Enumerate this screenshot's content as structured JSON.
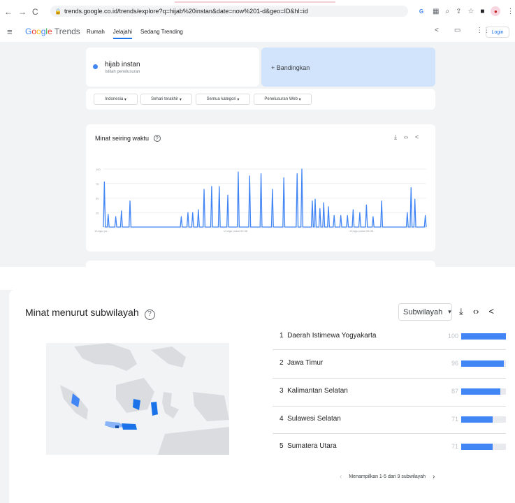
{
  "browser": {
    "url": "trends.google.co.id/trends/explore?q=hijab%20instan&date=now%201-d&geo=ID&hl=id",
    "profile_letter": "G"
  },
  "header": {
    "logo_google": "Google",
    "logo_trends": "Trends",
    "nav": [
      "Rumah",
      "Jelajahi",
      "Sedang Trending"
    ],
    "login": "Login"
  },
  "search": {
    "term": "hijab instan",
    "term_type": "Istilah penelusuran",
    "compare": "+ Bandingkan"
  },
  "filters": {
    "region": "Indonesia",
    "time": "Sehari terakhir",
    "category": "Semua kategori",
    "search_type": "Penelusuran Web"
  },
  "interest_over_time": {
    "title": "Minat seiring waktu",
    "x_labels": [
      "13 Agu pu...",
      "13 Agu pukul 00.36",
      "13 Agu pukul 08.36"
    ]
  },
  "chart_data": {
    "type": "line",
    "title": "Minat seiring waktu",
    "ylim": [
      0,
      100
    ],
    "y_ticks": [
      100,
      75,
      50,
      25
    ],
    "x_tick_labels": [
      "13 Agu pu...",
      "13 Agu pukul 00.36",
      "13 Agu pukul 08.36"
    ],
    "grid": true,
    "series": [
      {
        "color": "#4285f4",
        "values": [
          0,
          78,
          0,
          0,
          0,
          22,
          0,
          0,
          0,
          0,
          0,
          0,
          0,
          18,
          0,
          0,
          0,
          0,
          0,
          28,
          0,
          0,
          0,
          0,
          0,
          0,
          0,
          0,
          45,
          0,
          0,
          0,
          0,
          0,
          0,
          0,
          0,
          0,
          0,
          0,
          0,
          0,
          0,
          0,
          0,
          0,
          0,
          0,
          0,
          0,
          0,
          0,
          0,
          0,
          0,
          0,
          0,
          0,
          0,
          0,
          0,
          0,
          0,
          0,
          0,
          0,
          0,
          0,
          0,
          0,
          0,
          0,
          0,
          0,
          0,
          0,
          0,
          0,
          0,
          0,
          0,
          0,
          18,
          0,
          0,
          0,
          0,
          0,
          0,
          25,
          0,
          0,
          0,
          0,
          25,
          0,
          0,
          0,
          0,
          0,
          30,
          0,
          0,
          0,
          0,
          0,
          65,
          0,
          0,
          0,
          0,
          0,
          0,
          0,
          70,
          0,
          0,
          0,
          0,
          0,
          0,
          0,
          70,
          0,
          0,
          0,
          0,
          0,
          0,
          0,
          0,
          55,
          0,
          0,
          0,
          0,
          0,
          0,
          0,
          0,
          0,
          0,
          95,
          0,
          0,
          0,
          0,
          0,
          0,
          0,
          0,
          0,
          0,
          0,
          88,
          0,
          0,
          0,
          0,
          0,
          0,
          0,
          0,
          0,
          0,
          0,
          92,
          0,
          0,
          0,
          0,
          0,
          0,
          0,
          0,
          0,
          0,
          0,
          65,
          0,
          0,
          0,
          0,
          0,
          0,
          0,
          0,
          0,
          0,
          0,
          85,
          0,
          0,
          0,
          0,
          0,
          0,
          0,
          0,
          0,
          0,
          0,
          0,
          0,
          92,
          0,
          0,
          0,
          0,
          100,
          0,
          0,
          0,
          0,
          0,
          0,
          0,
          0,
          0,
          0,
          45,
          0,
          0,
          48,
          0,
          0,
          0,
          0,
          32,
          0,
          0,
          0,
          42,
          0,
          0,
          0,
          0,
          35,
          0,
          0,
          0,
          0,
          0,
          20,
          0,
          0,
          0,
          0,
          0,
          0,
          20,
          0,
          0,
          0,
          0,
          0,
          0,
          20,
          0,
          0,
          0,
          0,
          0,
          30,
          0,
          0,
          0,
          0,
          0,
          0,
          25,
          0,
          0,
          0,
          0,
          0,
          0,
          38,
          0,
          0,
          0,
          0,
          0,
          0,
          18,
          0,
          0,
          0,
          0,
          0,
          0,
          0,
          0,
          45,
          0,
          0,
          0,
          0,
          0,
          0,
          0,
          0,
          0,
          0,
          0,
          0,
          0,
          0,
          0,
          0,
          0,
          0,
          0,
          0,
          0,
          0,
          0,
          0,
          0,
          0,
          25,
          0,
          0,
          0,
          68,
          0,
          0,
          0,
          48,
          0,
          0,
          0,
          0,
          0,
          0,
          0,
          0,
          0,
          0,
          20,
          0
        ]
      }
    ]
  },
  "subregion": {
    "title": "Minat menurut subwilayah",
    "select_label": "Subwilayah",
    "pager": "Menampilkan 1-5 dari 9 subwilayah",
    "rows": [
      {
        "rank": "1",
        "name": "Daerah Istimewa Yogyakarta",
        "value": "100",
        "pct": 100
      },
      {
        "rank": "2",
        "name": "Jawa Timur",
        "value": "96",
        "pct": 96
      },
      {
        "rank": "3",
        "name": "Kalimantan Selatan",
        "value": "87",
        "pct": 87
      },
      {
        "rank": "4",
        "name": "Sulawesi Selatan",
        "value": "71",
        "pct": 71
      },
      {
        "rank": "5",
        "name": "Sumatera Utara",
        "value": "71",
        "pct": 71
      }
    ]
  },
  "colors": {
    "accent": "#4285f4",
    "compare_bg": "#d2e3fc",
    "page_bg": "#f1f3f4",
    "map_land": "#dadce0",
    "map_region": "#1a73e8"
  }
}
